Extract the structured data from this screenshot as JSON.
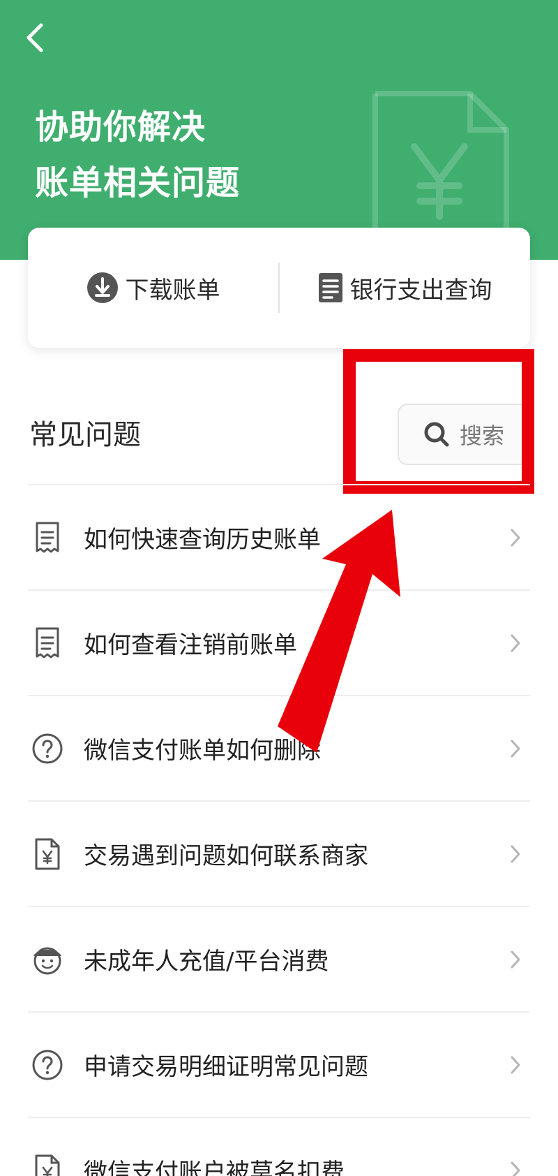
{
  "header": {
    "title_line1": "协助你解决",
    "title_line2": "账单相关问题",
    "bg_color": "#3fae6e"
  },
  "actions": {
    "download_label": "下载账单",
    "bank_label": "银行支出查询"
  },
  "section": {
    "title": "常见问题",
    "search_label": "搜索"
  },
  "faq": [
    {
      "label": "如何快速查询历史账单",
      "icon": "receipt-icon"
    },
    {
      "label": "如何查看注销前账单",
      "icon": "receipt-icon"
    },
    {
      "label": "微信支付账单如何删除",
      "icon": "question-circle-icon"
    },
    {
      "label": "交易遇到问题如何联系商家",
      "icon": "yuan-document-icon"
    },
    {
      "label": "未成年人充值/平台消费",
      "icon": "child-face-icon"
    },
    {
      "label": "申请交易明细证明常见问题",
      "icon": "question-circle-icon"
    },
    {
      "label": "微信支付账户被莫名扣费",
      "icon": "yuan-document-icon"
    }
  ],
  "annotation": {
    "highlight_color": "#e8000b"
  }
}
